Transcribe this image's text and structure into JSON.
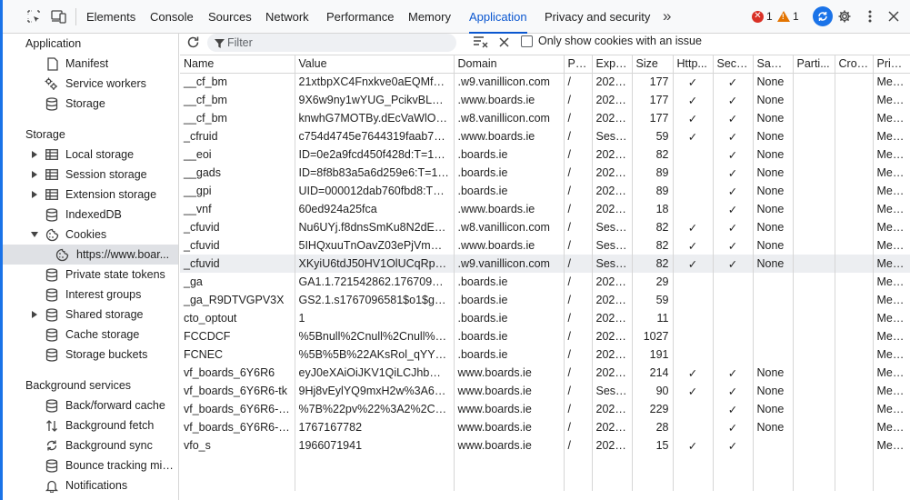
{
  "toolbar": {
    "tabs": [
      "Elements",
      "Console",
      "Sources",
      "Network",
      "Performance",
      "Memory",
      "Application",
      "Privacy and security"
    ],
    "more_tabs": "»",
    "errors": "1",
    "warnings": "1"
  },
  "sidebar": {
    "application_title": "Application",
    "application_items": [
      "Manifest",
      "Service workers",
      "Storage"
    ],
    "storage_title": "Storage",
    "storage_items": [
      "Local storage",
      "Session storage",
      "Extension storage",
      "IndexedDB",
      "Cookies"
    ],
    "cookie_origin": "https://www.boar...",
    "storage_items_after": [
      "Private state tokens",
      "Interest groups",
      "Shared storage",
      "Cache storage",
      "Storage buckets"
    ],
    "background_title": "Background services",
    "background_items": [
      "Back/forward cache",
      "Background fetch",
      "Background sync",
      "Bounce tracking mit...",
      "Notifications"
    ]
  },
  "cookie_toolbar": {
    "filter_placeholder": "Filter",
    "only_issues_label": "Only show cookies with an issue"
  },
  "table": {
    "columns": [
      "Name",
      "Value",
      "Domain",
      "Pa...",
      "Expir...",
      "Size",
      "Http...",
      "Secure",
      "Sam...",
      "Parti...",
      "Cros...",
      "Prior..."
    ],
    "rows": [
      {
        "name": "__cf_bm",
        "value": "21xtbpXC4Fnxkve0aEQMfCX_...",
        "domain": ".w9.vanillicon.com",
        "path": "/",
        "expires": "2025...",
        "size": "177",
        "http": "✓",
        "secure": "✓",
        "same": "None",
        "part": "",
        "cross": "",
        "prio": "Med..."
      },
      {
        "name": "__cf_bm",
        "value": "9X6w9ny1wYUG_PcikvBLpJFy...",
        "domain": ".www.boards.ie",
        "path": "/",
        "expires": "2025...",
        "size": "177",
        "http": "✓",
        "secure": "✓",
        "same": "None",
        "part": "",
        "cross": "",
        "prio": "Med..."
      },
      {
        "name": "__cf_bm",
        "value": "knwhG7MOTBy.dEcVaWlOPh...",
        "domain": ".w8.vanillicon.com",
        "path": "/",
        "expires": "2025...",
        "size": "177",
        "http": "✓",
        "secure": "✓",
        "same": "None",
        "part": "",
        "cross": "",
        "prio": "Med..."
      },
      {
        "name": "_cfruid",
        "value": "c754d4745e7644319faab71bf...",
        "domain": ".www.boards.ie",
        "path": "/",
        "expires": "Sessi...",
        "size": "59",
        "http": "✓",
        "secure": "✓",
        "same": "None",
        "part": "",
        "cross": "",
        "prio": "Med..."
      },
      {
        "name": "__eoi",
        "value": "ID=0e2a9fcd450f428d:T=176...",
        "domain": ".boards.ie",
        "path": "/",
        "expires": "2026...",
        "size": "82",
        "http": "",
        "secure": "✓",
        "same": "None",
        "part": "",
        "cross": "",
        "prio": "Med..."
      },
      {
        "name": "__gads",
        "value": "ID=8f8b83a5a6d259e6:T=17...",
        "domain": ".boards.ie",
        "path": "/",
        "expires": "2027...",
        "size": "89",
        "http": "",
        "secure": "✓",
        "same": "None",
        "part": "",
        "cross": "",
        "prio": "Med..."
      },
      {
        "name": "__gpi",
        "value": "UID=000012dab760fbd8:T=1...",
        "domain": ".boards.ie",
        "path": "/",
        "expires": "2027...",
        "size": "89",
        "http": "",
        "secure": "✓",
        "same": "None",
        "part": "",
        "cross": "",
        "prio": "Med..."
      },
      {
        "name": "__vnf",
        "value": "60ed924a25fca",
        "domain": ".www.boards.ie",
        "path": "/",
        "expires": "2026...",
        "size": "18",
        "http": "",
        "secure": "✓",
        "same": "None",
        "part": "",
        "cross": "",
        "prio": "Med..."
      },
      {
        "name": "_cfuvid",
        "value": "Nu6UYj.f8dnsSmKu8N2dEaln...",
        "domain": ".w8.vanillicon.com",
        "path": "/",
        "expires": "Sessi...",
        "size": "82",
        "http": "✓",
        "secure": "✓",
        "same": "None",
        "part": "",
        "cross": "",
        "prio": "Med..."
      },
      {
        "name": "_cfuvid",
        "value": "5IHQxuuTnOavZ03ePjVmGXv...",
        "domain": ".www.boards.ie",
        "path": "/",
        "expires": "Sessi...",
        "size": "82",
        "http": "✓",
        "secure": "✓",
        "same": "None",
        "part": "",
        "cross": "",
        "prio": "Med..."
      },
      {
        "name": "_cfuvid",
        "value": "XKyiU6tdJ50HV1OlUCqRpBPF...",
        "domain": ".w9.vanillicon.com",
        "path": "/",
        "expires": "Sessi...",
        "size": "82",
        "http": "✓",
        "secure": "✓",
        "same": "None",
        "part": "",
        "cross": "",
        "prio": "Med..."
      },
      {
        "name": "_ga",
        "value": "GA1.1.721542862.1767096581",
        "domain": ".boards.ie",
        "path": "/",
        "expires": "2027...",
        "size": "29",
        "http": "",
        "secure": "",
        "same": "",
        "part": "",
        "cross": "",
        "prio": "Med..."
      },
      {
        "name": "_ga_R9DTVGPV3X",
        "value": "GS2.1.s1767096581$o1$g1$t...",
        "domain": ".boards.ie",
        "path": "/",
        "expires": "2027...",
        "size": "59",
        "http": "",
        "secure": "",
        "same": "",
        "part": "",
        "cross": "",
        "prio": "Med..."
      },
      {
        "name": "cto_optout",
        "value": "1",
        "domain": ".boards.ie",
        "path": "/",
        "expires": "2027...",
        "size": "11",
        "http": "",
        "secure": "",
        "same": "",
        "part": "",
        "cross": "",
        "prio": "Med..."
      },
      {
        "name": "FCCDCF",
        "value": "%5Bnull%2Cnull%2Cnull%2C...",
        "domain": ".boards.ie",
        "path": "/",
        "expires": "2027...",
        "size": "1027",
        "http": "",
        "secure": "",
        "same": "",
        "part": "",
        "cross": "",
        "prio": "Med..."
      },
      {
        "name": "FCNEC",
        "value": "%5B%5B%22AKsRol_qYYbD0...",
        "domain": ".boards.ie",
        "path": "/",
        "expires": "2026...",
        "size": "191",
        "http": "",
        "secure": "",
        "same": "",
        "part": "",
        "cross": "",
        "prio": "Med..."
      },
      {
        "name": "vf_boards_6Y6R6",
        "value": "eyJ0eXAiOiJKV1QiLCJhbGciOi...",
        "domain": "www.boards.ie",
        "path": "/",
        "expires": "2026...",
        "size": "214",
        "http": "✓",
        "secure": "✓",
        "same": "None",
        "part": "",
        "cross": "",
        "prio": "Med..."
      },
      {
        "name": "vf_boards_6Y6R6-tk",
        "value": "9Hj8vEylYQ9mxH2w%3A6245...",
        "domain": "www.boards.ie",
        "path": "/",
        "expires": "Sessi...",
        "size": "90",
        "http": "✓",
        "secure": "✓",
        "same": "None",
        "part": "",
        "cross": "",
        "prio": "Med..."
      },
      {
        "name": "vf_boards_6Y6R6-vA",
        "value": "%7B%22pv%22%3A2%2C%2...",
        "domain": "www.boards.ie",
        "path": "/",
        "expires": "2027...",
        "size": "229",
        "http": "",
        "secure": "✓",
        "same": "None",
        "part": "",
        "cross": "",
        "prio": "Med..."
      },
      {
        "name": "vf_boards_6Y6R6-Vv",
        "value": "1767167782",
        "domain": "www.boards.ie",
        "path": "/",
        "expires": "2025...",
        "size": "28",
        "http": "",
        "secure": "✓",
        "same": "None",
        "part": "",
        "cross": "",
        "prio": "Med..."
      },
      {
        "name": "vfo_s",
        "value": "1966071941",
        "domain": "www.boards.ie",
        "path": "/",
        "expires": "2026...",
        "size": "15",
        "http": "✓",
        "secure": "✓",
        "same": "",
        "part": "",
        "cross": "",
        "prio": "Med..."
      }
    ]
  },
  "colors": {
    "accent": "#0b57d0",
    "error": "#d93025",
    "warning": "#e37400",
    "selected_row": "#eceef1"
  }
}
